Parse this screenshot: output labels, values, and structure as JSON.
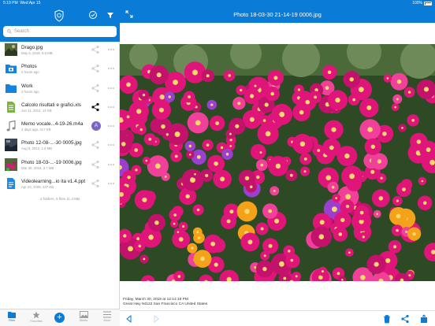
{
  "status_bar": {
    "time": "5:19 PM",
    "date": "Wed Apr 15",
    "battery": "100%"
  },
  "left_panel": {
    "search_placeholder": "Search",
    "files": [
      {
        "name": "Drago.jpg",
        "meta": "May 9, 2018, 6.9 MB",
        "icon": "image-thumbnail",
        "shared": false
      },
      {
        "name": "Photos",
        "meta": "2 hours ago",
        "icon": "camera-folder-icon",
        "shared": false
      },
      {
        "name": "Work",
        "meta": "2 hours ago",
        "icon": "folder-icon",
        "shared": false
      },
      {
        "name": "Calcolo risultati e grafici.xls",
        "meta": "Jun 11, 2014, 14 KB",
        "icon": "spreadsheet-icon",
        "shared": true
      },
      {
        "name": "Memo vocale...4-19-26.m4a",
        "meta": "4 days ago, 417 KB",
        "icon": "music-note-icon",
        "avatar": "A"
      },
      {
        "name": "Photo 12-08-...-30 0005.jpg",
        "meta": "Aug 8, 2012, 1.8 MB",
        "icon": "image-thumbnail",
        "shared": false
      },
      {
        "name": "Photo 18-03-...-19 0006.jpg",
        "meta": "Mar 30, 2018, 3.7 MB",
        "icon": "image-thumbnail",
        "shared": false
      },
      {
        "name": "Videolearning...io ita v1.4.ppt",
        "meta": "Apr 23, 2008, 237 KB",
        "icon": "document-icon",
        "shared": false
      }
    ],
    "summary": "2 folders, 6 files 11.4 MB"
  },
  "tabs": [
    {
      "label": "Files",
      "icon": "folder-icon",
      "active": true
    },
    {
      "label": "Favorites",
      "icon": "star-icon",
      "active": false
    },
    {
      "label": "",
      "icon": "plus-icon",
      "active": false
    },
    {
      "label": "Media",
      "icon": "image-icon",
      "active": false
    },
    {
      "label": "More",
      "icon": "menu-icon",
      "active": false
    }
  ],
  "viewer": {
    "title": "Photo 18-03-30 21-14-19 0006.jpg",
    "caption_line1": "Friday, March 30, 2018 at 12:14:19 PM",
    "caption_line2": "Great Hwy 94122 San Francisco CA United States"
  },
  "colors": {
    "accent": "#0a7bd6",
    "flower_magenta": "#e0157a",
    "flower_orange": "#f5a21b",
    "foliage": "#3f5f2c"
  }
}
